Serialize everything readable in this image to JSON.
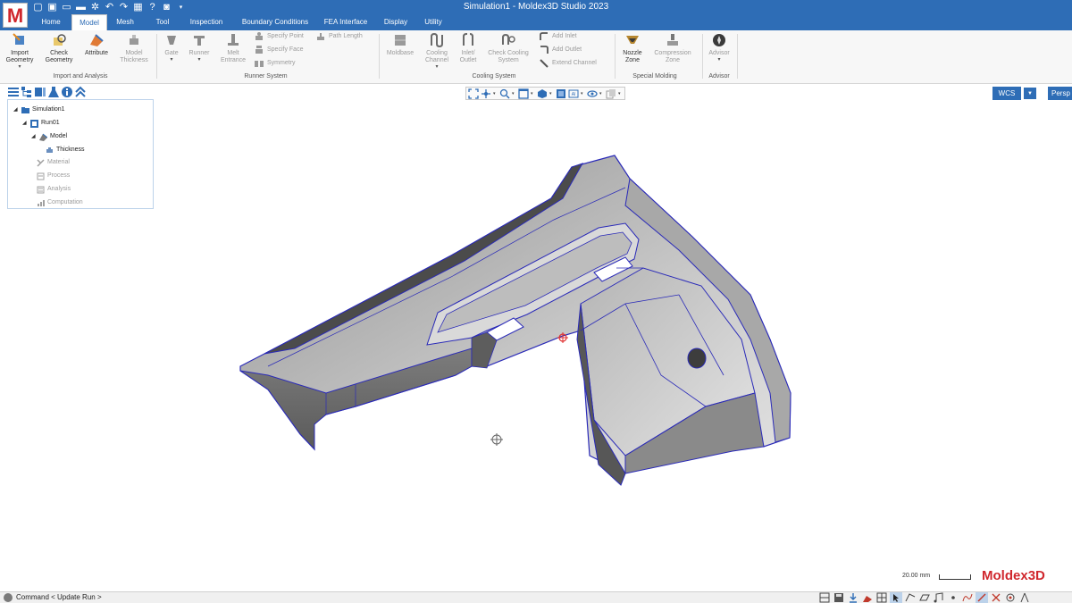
{
  "window": {
    "title": "Simulation1 - Moldex3D Studio 2023",
    "logo_letter": "M"
  },
  "quick_access": [
    "new",
    "save",
    "open",
    "folder",
    "settings",
    "undo",
    "redo",
    "calculator",
    "help",
    "camera",
    "dropdown"
  ],
  "tabs": [
    {
      "label": "Home",
      "active": false
    },
    {
      "label": "Model",
      "active": true
    },
    {
      "label": "Mesh",
      "active": false
    },
    {
      "label": "Tool",
      "active": false
    },
    {
      "label": "Inspection",
      "active": false
    },
    {
      "label": "Boundary Conditions",
      "active": false
    },
    {
      "label": "FEA Interface",
      "active": false
    },
    {
      "label": "Display",
      "active": false
    },
    {
      "label": "Utility",
      "active": false
    }
  ],
  "ribbon": {
    "import_geometry": "Import\nGeometry",
    "check_geometry": "Check\nGeometry",
    "attribute": "Attribute",
    "model_thickness": "Model\nThickness",
    "group_import": "Import and Analysis",
    "gate": "Gate",
    "runner": "Runner",
    "melt_entrance": "Melt\nEntrance",
    "specify_point": "Specify Point",
    "specify_face": "Specify Face",
    "symmetry": "Symmetry",
    "path_length": "Path Length",
    "group_runner": "Runner System",
    "moldbase": "Moldbase",
    "cooling_channel": "Cooling\nChannel",
    "inlet_outlet": "Inlet/\nOutlet",
    "check_cooling": "Check Cooling\nSystem",
    "add_inlet": "Add Inlet",
    "add_outlet": "Add Outlet",
    "extend_channel": "Extend Channel",
    "group_cooling": "Cooling System",
    "nozzle_zone": "Nozzle\nZone",
    "compression_zone": "Compression\nZone",
    "group_special": "Special Molding",
    "advisor": "Advisor",
    "group_advisor": "Advisor"
  },
  "tree": {
    "simulation": "Simulation1",
    "run": "Run01",
    "model": "Model",
    "thickness": "Thickness",
    "material": "Material",
    "process": "Process",
    "analysis": "Analysis",
    "computation": "Computation"
  },
  "view": {
    "wcs": "WCS",
    "persp": "Persp"
  },
  "scale": {
    "label": "20.00 mm"
  },
  "brand": {
    "prefix": "Moldex",
    "suffix": "3D"
  },
  "status": {
    "command": "Command < Update Run >"
  },
  "colors": {
    "title_blue": "#2e6db6",
    "brand_red": "#d0272d",
    "edge_blue": "#2a2ab8"
  }
}
